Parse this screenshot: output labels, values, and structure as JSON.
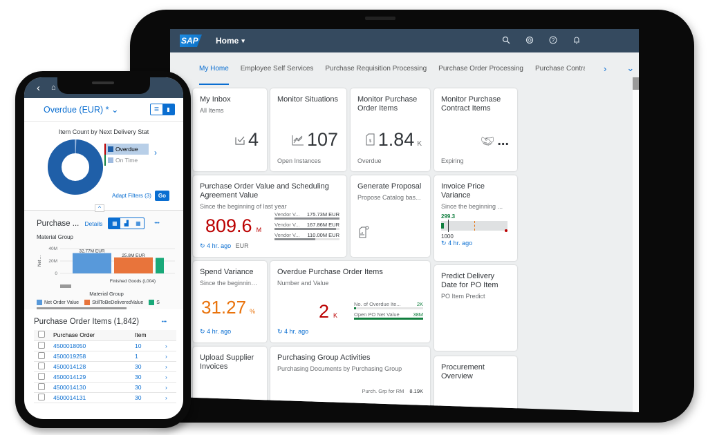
{
  "tablet": {
    "shell": {
      "logo": "SAP",
      "home_menu": "Home",
      "home_caret": "▾",
      "icons": [
        "search-icon",
        "notifications-copilot-icon",
        "help-icon",
        "bell-icon"
      ]
    },
    "tabs": [
      {
        "label": "My Home",
        "active": true
      },
      {
        "label": "Employee Self Services"
      },
      {
        "label": "Purchase Requisition Processing"
      },
      {
        "label": "Purchase Order Processing"
      },
      {
        "label": "Purchase Contra"
      }
    ],
    "tab_next": "›",
    "tab_overflow": "⌄",
    "tiles": {
      "inbox": {
        "title": "My Inbox",
        "subtitle": "All Items",
        "value": "4"
      },
      "situations": {
        "title": "Monitor Situations",
        "value": "107",
        "footer": "Open Instances"
      },
      "po_items": {
        "title": "Monitor Purchase Order Items",
        "value": "1.84",
        "unit": "K",
        "footer": "Overdue"
      },
      "contract_items": {
        "title": "Monitor Purchase Contract Items",
        "value": "...",
        "footer": "Expiring"
      },
      "po_value": {
        "title": "Purchase Order Value and Scheduling Agreement Value",
        "subtitle": "Since the beginning of last year",
        "value": "809.6",
        "unit": "M",
        "value_color": "#bb0000",
        "refresh": "4 hr. ago",
        "currency": "EUR",
        "bars": [
          {
            "label": "Vendor V...",
            "value": "175.73M EUR",
            "fraction": 1.0
          },
          {
            "label": "Vendor V...",
            "value": "167.86M EUR",
            "fraction": 0.95
          },
          {
            "label": "Vendor V...",
            "value": "110.00M EUR",
            "fraction": 0.63
          }
        ]
      },
      "proposal": {
        "title": "Generate Proposal",
        "subtitle": "Propose Catalog bas..."
      },
      "invoice_variance": {
        "title": "Invoice Price Variance",
        "subtitle": "Since the beginning ...",
        "actual": "299.3",
        "target": "1000",
        "refresh": "4 hr. ago"
      },
      "spend_variance": {
        "title": "Spend Variance",
        "subtitle": "Since the beginning ...",
        "value": "31.27",
        "unit": "%",
        "value_color": "#e9730c",
        "refresh": "4 hr. ago"
      },
      "overdue_po": {
        "title": "Overdue Purchase Order Items",
        "subtitle": "Number and Value",
        "value": "2",
        "unit": "K",
        "value_color": "#bb0000",
        "refresh": "4 hr. ago",
        "bars": [
          {
            "label": "No. of Overdue Ite...",
            "value": "2K",
            "fraction": 0.03
          },
          {
            "label": "Open PO Net Value",
            "value": "38M",
            "fraction": 1.0
          }
        ]
      },
      "predict": {
        "title": "Predict Delivery Date for PO Item",
        "subtitle": "PO Item Predict"
      },
      "upload": {
        "title": "Upload Supplier Invoices"
      },
      "group_activities": {
        "title": "Purchasing Group Activities",
        "subtitle": "Purchasing Documents by Purchasing Group",
        "bar_label": "Purch. Grp for RM",
        "bar_value": "8.19K"
      },
      "overview": {
        "title": "Procurement Overview"
      }
    }
  },
  "phone": {
    "nav": {
      "back": "‹",
      "home": "⌂"
    },
    "header_title": "Overdue (EUR) *",
    "header_caret": "⌄",
    "donut": {
      "title": "Item Count by Next Delivery Stat",
      "legend": [
        {
          "label": "Overdue",
          "color": "#1f5fa8",
          "selected": true
        },
        {
          "label": "On Time",
          "color": "#9fbbe0"
        }
      ],
      "overdue_fraction": 0.99
    },
    "adapt_filters": "Adapt Filters (3)",
    "go": "Go",
    "purchase_card": {
      "title": "Purchase ...",
      "details": "Details",
      "subtitle": "Material Group",
      "more": "•••",
      "y_label": "Net ...",
      "y_ticks": [
        "40M",
        "20M",
        "0"
      ],
      "bars": [
        {
          "label": "32.77M EUR",
          "value": 32.77,
          "color": "#5899da"
        },
        {
          "label": "25.8M EUR",
          "value": 25.8,
          "color": "#e8743b"
        },
        {
          "label": "",
          "value": 25,
          "color": "#19a979"
        }
      ],
      "category": "Finished Goods (L004)",
      "x_title": "Material Group",
      "legend": [
        {
          "label": "Net Order Value",
          "color": "#5899da"
        },
        {
          "label": "StillToBeDeliveredValue",
          "color": "#e8743b"
        },
        {
          "label": "S",
          "color": "#19a979"
        }
      ]
    },
    "items_table": {
      "title": "Purchase Order Items (1,842)",
      "more": "•••",
      "columns": [
        "Purchase Order",
        "Item"
      ],
      "rows": [
        {
          "po": "4500018050",
          "item": "10"
        },
        {
          "po": "4500019258",
          "item": "1"
        },
        {
          "po": "4500014128",
          "item": "30"
        },
        {
          "po": "4500014129",
          "item": "30"
        },
        {
          "po": "4500014130",
          "item": "30"
        },
        {
          "po": "4500014131",
          "item": "30"
        }
      ]
    }
  }
}
